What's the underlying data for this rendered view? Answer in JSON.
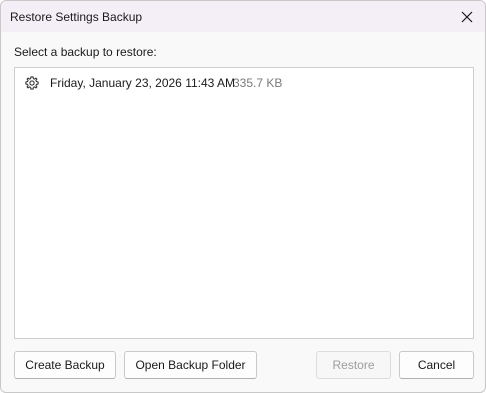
{
  "window": {
    "title": "Restore Settings Backup",
    "close_icon": "close-icon"
  },
  "prompt": "Select a backup to restore:",
  "backups": [
    {
      "icon": "gear-icon",
      "date": "Friday, January 23, 2026 11:43 AM",
      "size": "335.7 KB"
    }
  ],
  "buttons": {
    "create_backup": "Create Backup",
    "open_backup_folder": "Open Backup Folder",
    "restore": "Restore",
    "cancel": "Cancel"
  },
  "colors": {
    "titlebar": "#f4eff7",
    "disabled_text": "#9d9d9d",
    "secondary_text": "#7a7a7a"
  }
}
